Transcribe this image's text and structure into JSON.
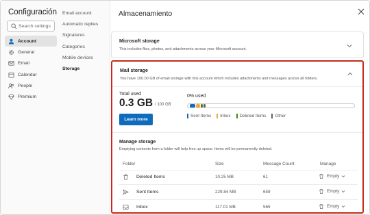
{
  "app": {
    "title": "Configuración"
  },
  "search": {
    "placeholder": "Search settings"
  },
  "nav": {
    "items": [
      {
        "label": "Account",
        "icon": "person-icon",
        "active": true
      },
      {
        "label": "General",
        "icon": "gear-icon"
      },
      {
        "label": "Email",
        "icon": "mail-icon"
      },
      {
        "label": "Calendar",
        "icon": "calendar-icon"
      },
      {
        "label": "People",
        "icon": "people-icon"
      },
      {
        "label": "Premium",
        "icon": "diamond-icon"
      }
    ]
  },
  "subnav": {
    "items": [
      {
        "label": "Email account"
      },
      {
        "label": "Automatic replies"
      },
      {
        "label": "Signatures"
      },
      {
        "label": "Categories"
      },
      {
        "label": "Mobile devices"
      },
      {
        "label": "Storage",
        "active": true
      }
    ]
  },
  "page": {
    "title": "Almacenamiento"
  },
  "microsoft_storage": {
    "title": "Microsoft storage",
    "description": "This includes files, photos, and attachments across your Microsoft account."
  },
  "mail_storage": {
    "title": "Mail storage",
    "description": "You have 100.00 GB of email storage with this account which includes attachments and messages across all folders.",
    "total_used_label": "Total used",
    "total_used_value": "0.3 GB",
    "total_capacity": "/ 100 GB",
    "learn_more_label": "Learn more",
    "percent_used_label": "0% used",
    "percent_used": 0.3,
    "legend": [
      {
        "label": "Sent Items",
        "color": "#0f6cbd",
        "mb": 229.84
      },
      {
        "label": "Inbox",
        "color": "#f2a73b",
        "mb": 117.01
      },
      {
        "label": "Deleted Items",
        "color": "#498205",
        "mb": 10.25
      },
      {
        "label": "Other",
        "color": "#616161",
        "mb": 0
      }
    ]
  },
  "manage_storage": {
    "title": "Manage storage",
    "description": "Emptying contents from a folder will help free up space. Items will be permanently deleted.",
    "columns": {
      "folder": "Folder",
      "size": "Size",
      "count": "Message Count",
      "manage": "Manage"
    },
    "rows": [
      {
        "folder": "Deleted Items",
        "icon": "trash-icon",
        "size": "10.25 MB",
        "count": "61",
        "action": "Empty"
      },
      {
        "folder": "Sent Items",
        "icon": "send-icon",
        "size": "229.84 MB",
        "count": "659",
        "action": "Empty"
      },
      {
        "folder": "Inbox",
        "icon": "inbox-icon",
        "size": "117.01 MB",
        "count": "565",
        "action": "Empty"
      }
    ]
  },
  "colors": {
    "accent": "#0f6cbd",
    "highlight_border": "#c42b1c"
  }
}
